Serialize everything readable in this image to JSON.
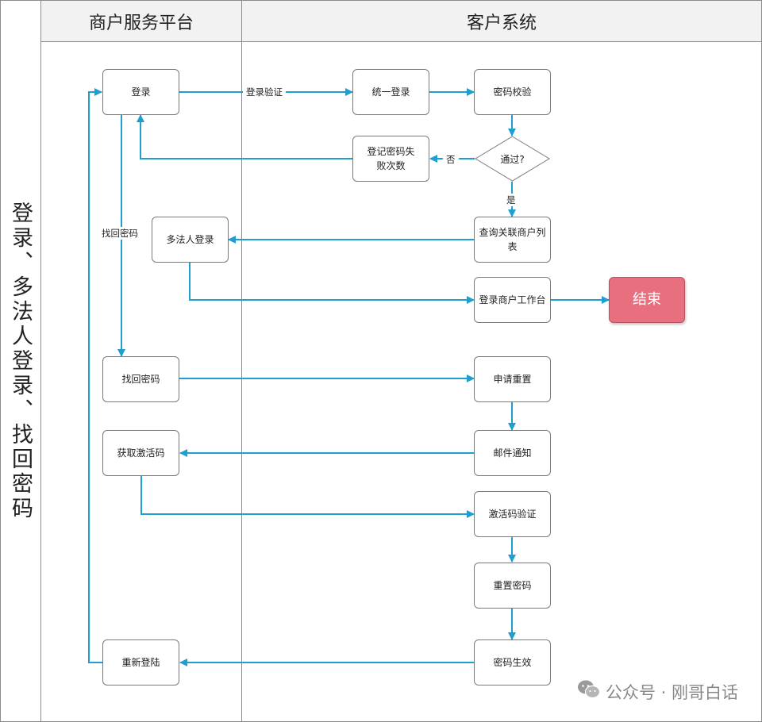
{
  "diagram": {
    "title": "登录、多法人登录、找回密码",
    "lanes": [
      {
        "id": "merchant",
        "label": "商户服务平台"
      },
      {
        "id": "customer",
        "label": "客户系统"
      }
    ],
    "nodes": {
      "login": "登录",
      "unified_login": "统一登录",
      "pwd_check": "密码校验",
      "passed": "通过?",
      "record_fail": "登记密码失败次数",
      "multi_login": "多法人登录",
      "query_list": "查询关联商户列表",
      "enter_workbench": "登录商户工作台",
      "end": "结束",
      "find_pwd": "找回密码",
      "apply_reset": "申请重置",
      "get_code": "获取激活码",
      "mail_notice": "邮件通知",
      "verify_code": "激活码验证",
      "reset_pwd": "重置密码",
      "relogin": "重新登陆",
      "pwd_effective": "密码生效"
    },
    "edge_labels": {
      "login_verify": "登录验证",
      "no": "否",
      "yes": "是",
      "find_pwd": "找回密码"
    },
    "colors": {
      "arrow": "#1e9fcf",
      "end_fill": "#e8707e",
      "border": "#7a7a7a"
    }
  },
  "watermark": {
    "icon": "wechat-icon",
    "text": "公众号 · 刚哥白话"
  }
}
